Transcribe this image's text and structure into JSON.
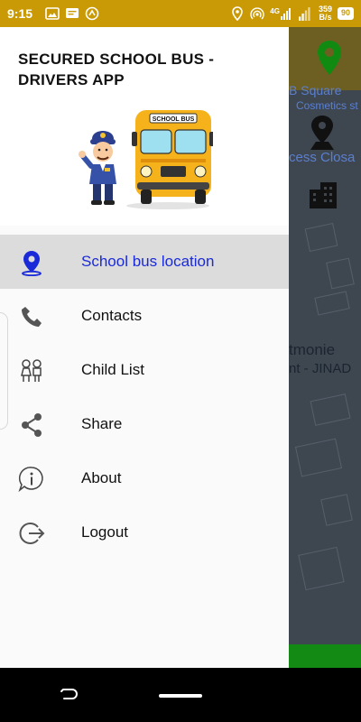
{
  "status_bar": {
    "time": "9:15",
    "network_type": "4G",
    "net_speed_value": "359",
    "net_speed_unit": "B/s",
    "battery": "90",
    "background_color": "#c99a06"
  },
  "drawer": {
    "title": "SECURED SCHOOL BUS - DRIVERS APP",
    "illustration": {
      "bus_sign": "SCHOOL BUS",
      "icon": "school-bus-driver-illustration"
    },
    "menu": [
      {
        "label": "School bus location",
        "icon": "location-pin-icon",
        "active": true
      },
      {
        "label": "Contacts",
        "icon": "phone-icon",
        "active": false
      },
      {
        "label": "Child List",
        "icon": "children-icon",
        "active": false
      },
      {
        "label": "Share",
        "icon": "share-icon",
        "active": false
      },
      {
        "label": "About",
        "icon": "info-icon",
        "active": false
      },
      {
        "label": "Logout",
        "icon": "logout-icon",
        "active": false
      }
    ],
    "active_color": "#1a2ad8"
  },
  "map": {
    "labels": [
      "B Square",
      "Cosmetics st",
      "cess Closa",
      "tmonie",
      "nt - JINAD"
    ]
  }
}
